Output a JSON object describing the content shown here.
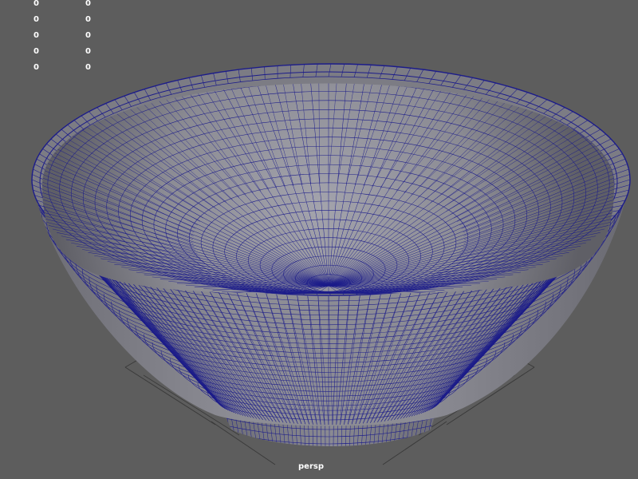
{
  "viewport": {
    "camera_label": "persp",
    "background_color": "#5d5d5d",
    "wireframe_color": "#1c1c8a",
    "grid_color": "#3a3a3a"
  },
  "hud": {
    "rows": [
      {
        "col1": "0",
        "col2": "0"
      },
      {
        "col1": "0",
        "col2": "0"
      },
      {
        "col1": "0",
        "col2": "0"
      },
      {
        "col1": "0",
        "col2": "0"
      },
      {
        "col1": "0",
        "col2": "0"
      }
    ]
  },
  "object": {
    "type": "bowl",
    "display_mode": "wireframe-on-shaded"
  }
}
